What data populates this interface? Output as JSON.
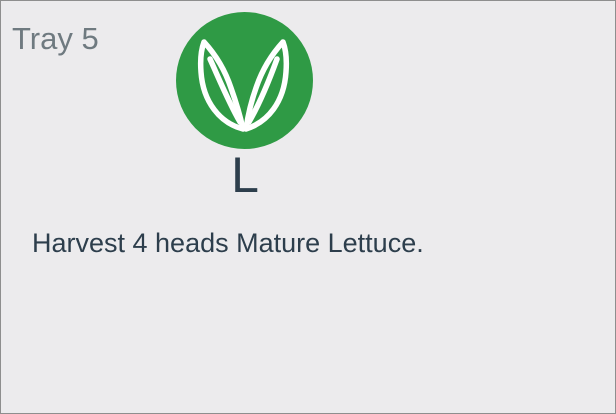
{
  "tray": {
    "title": "Tray 5",
    "icon": "leaf-sprout-icon",
    "icon_color": "#2f9a45",
    "letter": "L",
    "instruction": "Harvest 4 heads Mature Lettuce."
  }
}
